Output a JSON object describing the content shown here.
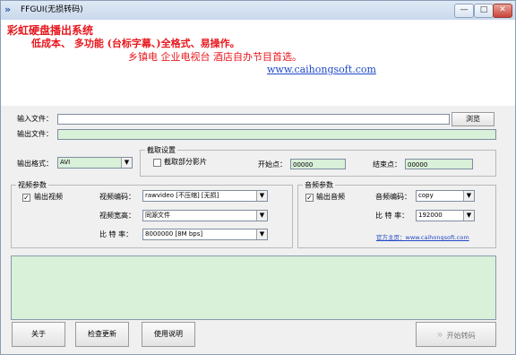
{
  "window": {
    "title": "FFGUI(无损转码)",
    "min": "—",
    "max": "□",
    "close": "✕"
  },
  "banner": {
    "line1": "彩虹硬盘播出系统",
    "line2": "低成本、 多功能 (台标字幕、)全格式、易操作。",
    "line3": "乡镇电 企业电视台 酒店自办节目首选。",
    "link": "www.caihongsoft.com"
  },
  "files": {
    "input_label": "输入文件：",
    "input_value": "",
    "browse": "浏览",
    "output_label": "输出文件：",
    "output_value": ""
  },
  "format": {
    "label": "输出格式：",
    "value": "AVI"
  },
  "clip": {
    "group": "截取设置",
    "checkbox": "截取部分影片",
    "checked": false,
    "start_label": "开始点：",
    "start_value": "00000",
    "end_label": "结束点：",
    "end_value": "00000"
  },
  "video": {
    "group": "视频参数",
    "output_checkbox": "输出视频",
    "output_checked": true,
    "codec_label": "视频编码：",
    "codec_value": "rawvideo [不压缩] [无损]",
    "size_label": "视频宽高：",
    "size_value": "同源文件",
    "bitrate_label": "比 特 率：",
    "bitrate_value": "8000000 [8M bps]"
  },
  "audio": {
    "group": "音频参数",
    "output_checkbox": "输出音频",
    "output_checked": true,
    "codec_label": "音频编码：",
    "codec_value": "copy",
    "bitrate_label": "比 特 率：",
    "bitrate_value": "192000",
    "homepage": "官方主页：www.caihongsoft.com"
  },
  "log": "",
  "buttons": {
    "about": "关于",
    "update": "检查更新",
    "help": "使用说明",
    "start": "开始转码"
  }
}
